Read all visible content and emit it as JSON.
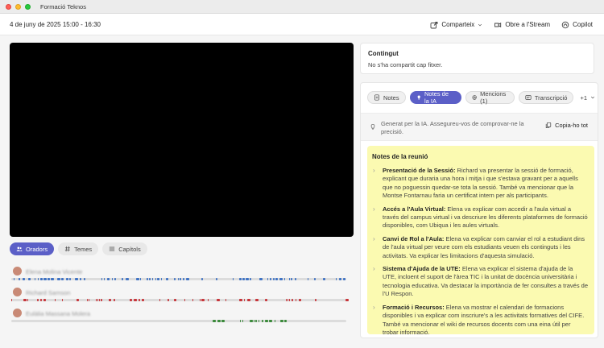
{
  "window": {
    "title": "Formació Teknos"
  },
  "header": {
    "meeting_time": "4 de juny de 2025 15:00 - 16:30",
    "share_label": "Comparteix",
    "stream_label": "Obre a l'Stream",
    "copilot_label": "Copilot"
  },
  "view_tabs": {
    "speakers": "Oradors",
    "topics": "Temes",
    "chapters": "Capítols"
  },
  "speakers": [
    {
      "name": "Elena Molina Vicente",
      "color": "#3f73c4"
    },
    {
      "name": "Richard Samson",
      "color": "#c7353a"
    },
    {
      "name": "Eulàlia Massana Molera",
      "color": "#3b8a3b"
    }
  ],
  "content_card": {
    "title": "Contingut",
    "text": "No s'ha compartit cap fitxer."
  },
  "panel_tabs": {
    "notes": "Notes",
    "ai_notes": "Notes de la IA",
    "mentions": "Mencions (1)",
    "transcript": "Transcripció",
    "more": "+1"
  },
  "ai_disclaimer": {
    "text": "Generat per la IA. Assegureu-vos de comprovar-ne la precisió.",
    "copy_label": "Copia-ho tot"
  },
  "notes": {
    "title": "Notes de la reunió",
    "items": [
      {
        "heading": "Presentació de la Sessió:",
        "text": " Richard va presentar la sessió de formació, explicant que duraria una hora i mitja i que s'estava gravant per a aquells que no poguessin quedar-se tota la sessió. També va mencionar que la Montse Fontarnau faria un certificat intern per als participants."
      },
      {
        "heading": "Accés a l'Aula Virtual:",
        "text": " Elena va explicar com accedir a l'aula virtual a través del campus virtual i va descriure les diferents plataformes de formació disponibles, com Ubiqua i les aules virtuals."
      },
      {
        "heading": "Canvi de Rol a l'Aula:",
        "text": " Elena va explicar com canviar el rol a estudiant dins de l'aula virtual per veure com els estudiants veuen els continguts i les activitats. Va explicar les limitacions d'aquesta simulació."
      },
      {
        "heading": "Sistema d'Ajuda de la UTE:",
        "text": " Elena va explicar el sistema d'ajuda de la UTE, incloent el suport de l'àrea TIC i la unitat de docència universitària i tecnologia educativa. Va destacar la importància de fer consultes a través de l'U Respon."
      },
      {
        "heading": "Formació i Recursos:",
        "text": " Elena va mostrar el calendari de formacions disponibles i va explicar com inscriure's a les activitats formatives del CIFE. També va mencionar el wiki de recursos docents com una eina útil per trobar informació."
      }
    ]
  },
  "colors": {
    "accent": "#5b5fc7",
    "notes_bg": "#fbfab1"
  }
}
